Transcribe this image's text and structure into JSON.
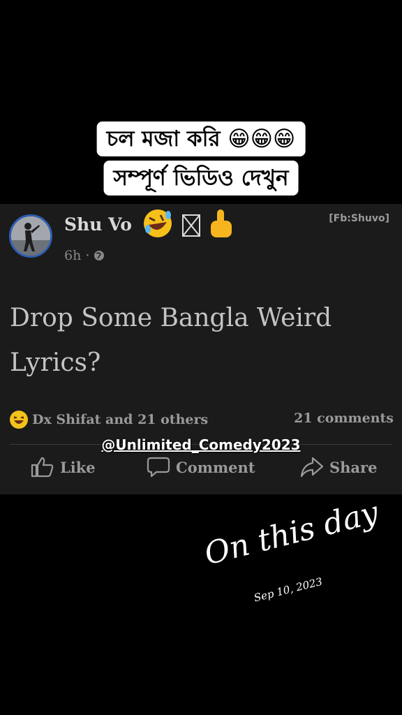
{
  "caption": {
    "line1": "চল মজা করি 😁😁😁",
    "line2": "সম্পূর্ণ ভিডিও দেখুন"
  },
  "post": {
    "author": "Shu Vo",
    "time": "6h ·",
    "source": "[Fb:Shuvo]",
    "text_line1": "Drop Some Bangla Weird",
    "text_line2": "Lyrics?",
    "reactions_text": "Dx Shifat and 21 others",
    "comments_count": "21 comments",
    "watermark": "@Unlimited_Comedy2023",
    "actions": {
      "like": "Like",
      "comment": "Comment",
      "share": "Share"
    }
  },
  "overlay": {
    "title": "On this day",
    "date": "Sep 10, 2023"
  }
}
